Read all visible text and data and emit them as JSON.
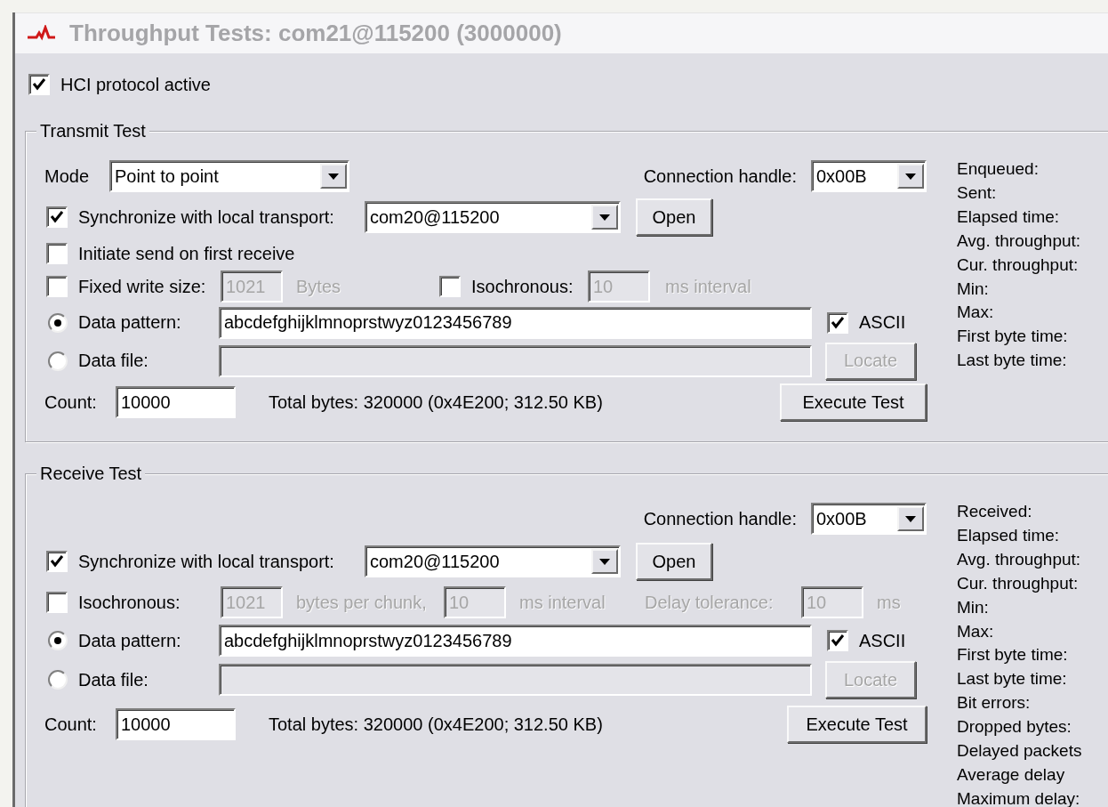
{
  "window": {
    "title": "Throughput Tests: com21@115200 (3000000)"
  },
  "hci_protocol": {
    "label": "HCI protocol active",
    "checked": true
  },
  "transmit_test": {
    "title": "Transmit Test",
    "mode": {
      "label": "Mode",
      "value": "Point to point"
    },
    "connection_handle": {
      "label": "Connection handle:",
      "value": "0x00B"
    },
    "synchronize": {
      "label": "Synchronize with local transport:",
      "checked": true,
      "port": "com20@115200",
      "button": "Open"
    },
    "initiate_send": {
      "label": "Initiate send on first receive",
      "checked": false
    },
    "fixed_write_size": {
      "label": "Fixed write size:",
      "checked": false,
      "value": "1021",
      "unit": "Bytes"
    },
    "isochronous": {
      "label": "Isochronous:",
      "checked": false,
      "interval": "10",
      "interval_unit": "ms interval"
    },
    "source": [
      {
        "kind": "pattern",
        "label": "Data pattern:",
        "selected": true,
        "value": "abcdefghijklmnoprstwyz0123456789",
        "option": {
          "label": "ASCII",
          "checked": true
        }
      },
      {
        "kind": "file",
        "label": "Data file:",
        "selected": false,
        "button": "Locate"
      }
    ],
    "count": {
      "label": "Count:",
      "value": "10000"
    },
    "total_bytes": "Total bytes: 320000 (0x4E200; 312.50 KB)",
    "execute_button": "Execute Test",
    "stats": [
      "Enqueued:",
      "Sent:",
      "Elapsed time:",
      "Avg. throughput:",
      "Cur. throughput:",
      "Min:",
      "Max:",
      "First byte time:",
      "Last byte time:"
    ]
  },
  "receive_test": {
    "title": "Receive Test",
    "connection_handle": {
      "label": "Connection handle:",
      "value": "0x00B"
    },
    "synchronize": {
      "label": "Synchronize with local transport:",
      "checked": true,
      "port": "com20@115200",
      "button": "Open"
    },
    "isochronous": {
      "label": "Isochronous:",
      "checked": false,
      "chunk": "1021",
      "chunk_unit": "bytes per chunk,",
      "interval": "10",
      "interval_unit": "ms interval",
      "tolerance_label": "Delay tolerance:",
      "tolerance": "10",
      "tolerance_unit": "ms"
    },
    "source": [
      {
        "kind": "pattern",
        "label": "Data pattern:",
        "selected": true,
        "value": "abcdefghijklmnoprstwyz0123456789",
        "option": {
          "label": "ASCII",
          "checked": true
        }
      },
      {
        "kind": "file",
        "label": "Data file:",
        "selected": false,
        "button": "Locate"
      }
    ],
    "count": {
      "label": "Count:",
      "value": "10000"
    },
    "total_bytes": "Total bytes: 320000 (0x4E200; 312.50 KB)",
    "execute_button": "Execute Test",
    "stats": [
      "Received:",
      "Elapsed time:",
      "Avg. throughput:",
      "Cur. throughput:",
      "Min:",
      "Max:",
      "First byte time:",
      "Last byte time:",
      "Bit errors:",
      "Dropped bytes:",
      "Delayed packets",
      "Average delay",
      "Maximum delay:"
    ]
  }
}
